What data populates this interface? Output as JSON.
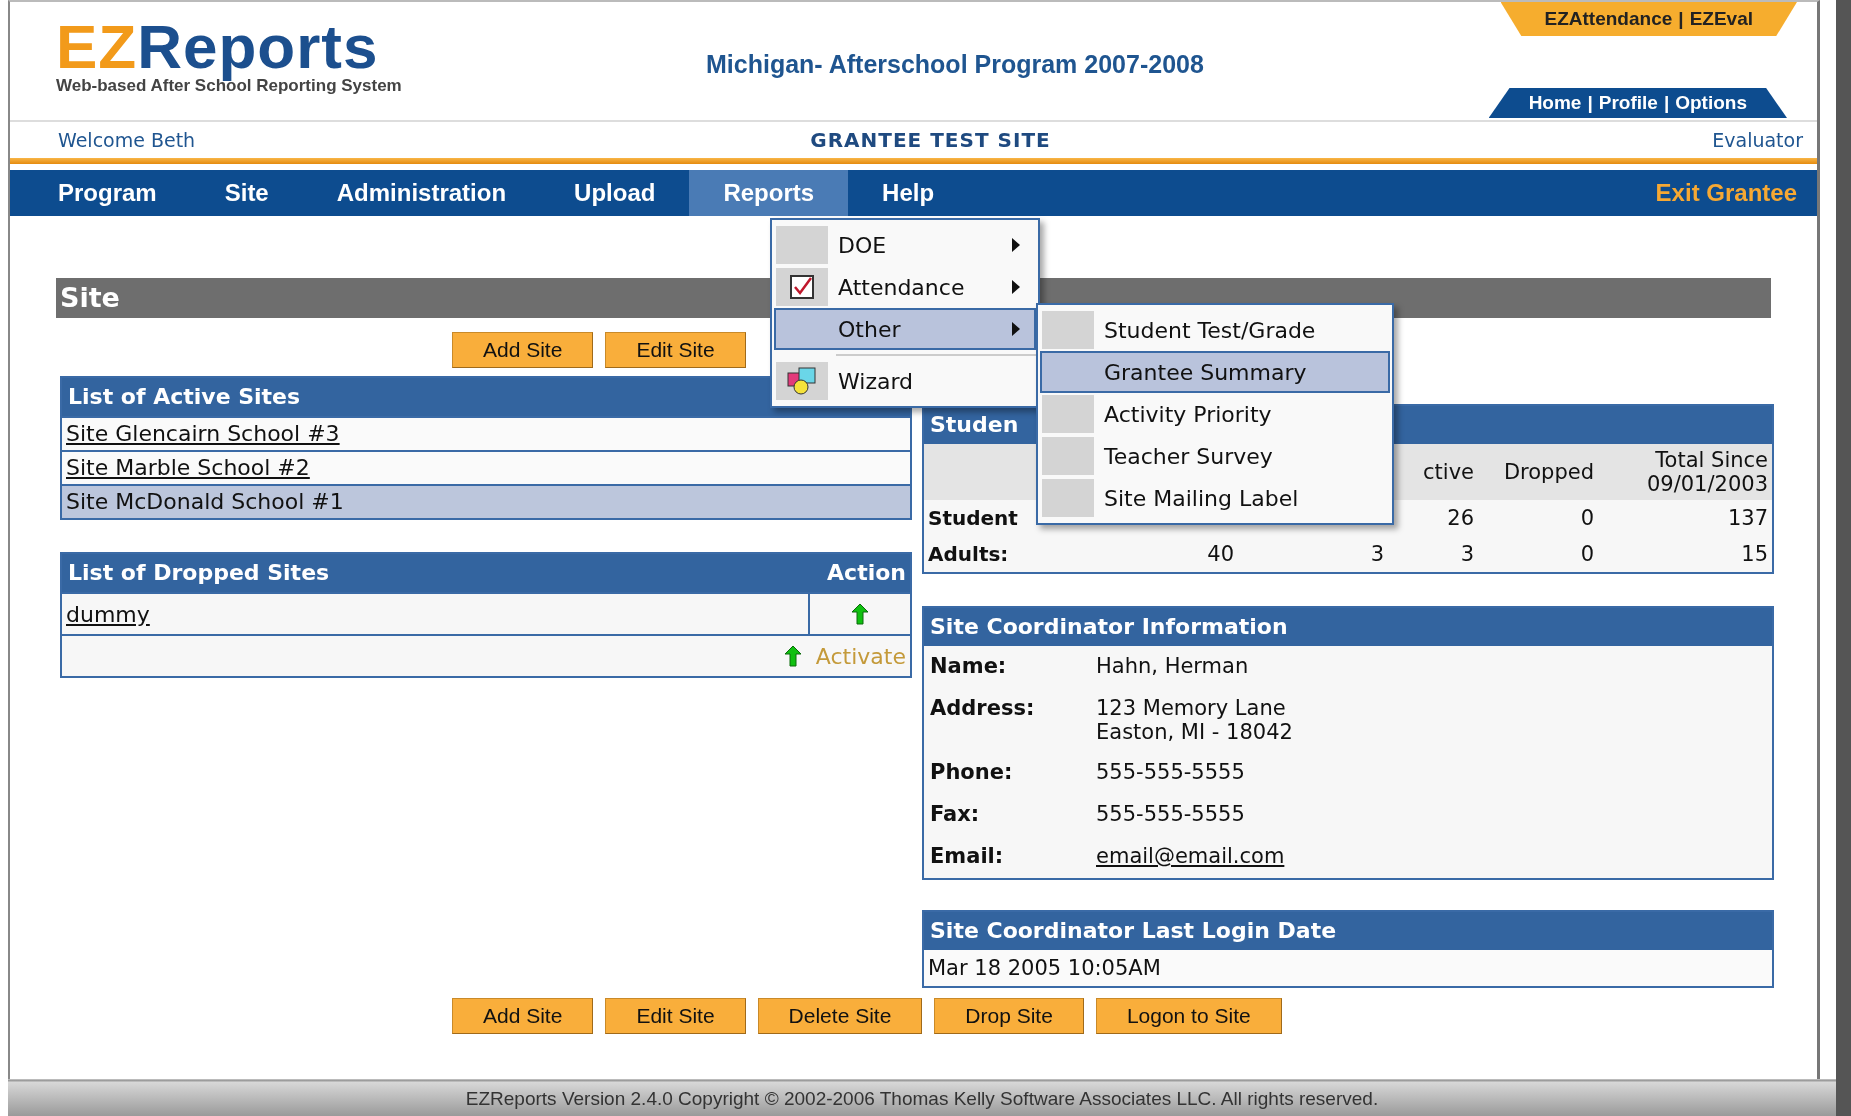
{
  "header": {
    "logo": {
      "prefix": "EZ",
      "name": "Reports"
    },
    "tagline": "Web-based After School Reporting System",
    "program_title": "Michigan- Afterschool Program 2007-2008",
    "top_links": [
      {
        "label": "EZAttendance",
        "kind": "link"
      },
      {
        "label": "|",
        "kind": "separator"
      },
      {
        "label": "EZEval",
        "kind": "link"
      }
    ],
    "account_links": [
      {
        "label": "Home",
        "kind": "link"
      },
      {
        "label": "|",
        "kind": "separator"
      },
      {
        "label": "Profile",
        "kind": "link"
      },
      {
        "label": "|",
        "kind": "separator"
      },
      {
        "label": "Options",
        "kind": "link"
      }
    ]
  },
  "welcome_bar": {
    "welcome": "Welcome Beth",
    "site_name": "GRANTEE TEST SITE",
    "role": "Evaluator"
  },
  "nav": {
    "items": [
      {
        "label": "Program",
        "selected": false
      },
      {
        "label": "Site",
        "selected": false
      },
      {
        "label": "Administration",
        "selected": false
      },
      {
        "label": "Upload",
        "selected": false
      },
      {
        "label": "Reports",
        "selected": true
      },
      {
        "label": "Help",
        "selected": false
      }
    ],
    "exit": "Exit Grantee"
  },
  "reports_menu": {
    "items": [
      {
        "label": "DOE",
        "kind": "submenu",
        "selected": false
      },
      {
        "label": "Attendance",
        "kind": "submenu",
        "selected": false
      },
      {
        "label": "Other",
        "kind": "submenu",
        "selected": true
      },
      {
        "label": "Wizard",
        "kind": "action",
        "selected": false
      }
    ]
  },
  "other_submenu": {
    "items": [
      {
        "label": "Student Test/Grade",
        "selected": false
      },
      {
        "label": "Grantee Summary",
        "selected": true
      },
      {
        "label": "Activity Priority",
        "selected": false
      },
      {
        "label": "Teacher Survey",
        "selected": false
      },
      {
        "label": "Site Mailing Label",
        "selected": false
      }
    ]
  },
  "site": {
    "title": "Site",
    "top_buttons": [
      "Add Site",
      "Edit Site"
    ],
    "active_sites": {
      "title": "List of Active Sites",
      "rows": [
        {
          "label": "Site Glencairn School #3",
          "selected": false
        },
        {
          "label": "Site Marble School #2",
          "selected": false
        },
        {
          "label": "Site McDonald School #1",
          "selected": true
        }
      ]
    },
    "dropped_sites": {
      "title": "List of Dropped Sites",
      "action_heading": "Action",
      "rows": [
        {
          "label": "dummy"
        }
      ],
      "activate": "Activate"
    }
  },
  "students": {
    "title": "Studen",
    "columns": [
      "",
      "",
      "ctive",
      "Dropped",
      "Total Since 09/01/2003"
    ],
    "rows": [
      {
        "label": "Student",
        "cells": [
          "",
          "",
          "26",
          "0",
          "137"
        ]
      },
      {
        "label": "Adults:",
        "cells": [
          "40",
          "3",
          "3",
          "0",
          "15"
        ]
      }
    ]
  },
  "coordinator": {
    "title": "Site Coordinator Information",
    "fields": [
      {
        "label": "Name:",
        "lines": [
          "Hahn, Herman"
        ],
        "kind": "text"
      },
      {
        "label": "Address:",
        "lines": [
          "123 Memory Lane",
          "Easton, MI - 18042"
        ],
        "kind": "text"
      },
      {
        "label": "Phone:",
        "lines": [
          "555-555-5555"
        ],
        "kind": "text"
      },
      {
        "label": "Fax:",
        "lines": [
          "555-555-5555"
        ],
        "kind": "text"
      },
      {
        "label": "Email:",
        "lines": [
          "email@email.com"
        ],
        "kind": "link"
      }
    ]
  },
  "last_login": {
    "title": "Site Coordinator Last Login Date",
    "value": "Mar 18 2005 10:05AM"
  },
  "bottom_buttons": [
    "Add Site",
    "Edit Site",
    "Delete Site",
    "Drop Site",
    "Logon to Site"
  ],
  "footer": "EZReports Version 2.4.0 Copyright © 2002-2006 Thomas Kelly Software Associates LLC. All rights reserved."
}
